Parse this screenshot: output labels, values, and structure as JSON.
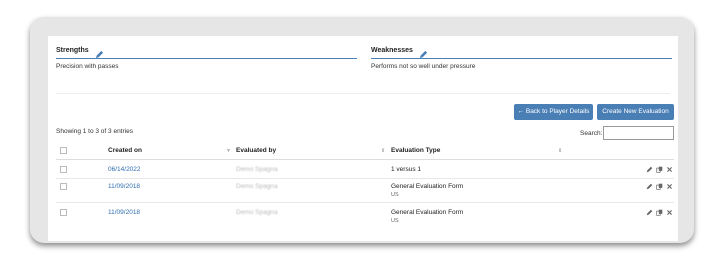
{
  "strengths": {
    "title": "Strengths",
    "text": "Precision with passes"
  },
  "weaknesses": {
    "title": "Weaknesses",
    "text": "Performs not so well under pressure"
  },
  "buttons": {
    "back": "← Back to Player Details",
    "create": "Create New Evaluation"
  },
  "showing": "Showing 1 to 3 of 3 entries",
  "search_label": "Search:",
  "table": {
    "headers": {
      "created_on": "Created on",
      "evaluated_by": "Evaluated by",
      "evaluation_type": "Evaluation Type"
    },
    "rows": [
      {
        "created_on": "06/14/2022",
        "evaluated_by": "Demo Spagna",
        "type": "1 versus 1",
        "sub": ""
      },
      {
        "created_on": "11/09/2018",
        "evaluated_by": "Demo Spagna",
        "type": "General Evaluation Form",
        "sub": "US"
      },
      {
        "created_on": "11/09/2018",
        "evaluated_by": "Demo Spagna",
        "type": "General Evaluation Form",
        "sub": "US"
      }
    ]
  },
  "colors": {
    "accent": "#4a7fb5",
    "link": "#2f6db0"
  }
}
